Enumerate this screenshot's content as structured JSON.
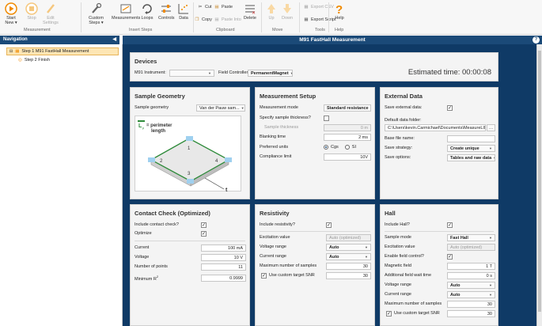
{
  "ribbon": {
    "buttons": [
      {
        "id": "start",
        "label": "Start\nNew ▾",
        "enabled": true
      },
      {
        "id": "stop",
        "label": "Stop",
        "enabled": false
      },
      {
        "id": "edit",
        "label": "Edit\nSettings",
        "enabled": false
      },
      {
        "id": "custom",
        "label": "Custom\nSteps ▾",
        "enabled": true
      },
      {
        "id": "measurements",
        "label": "Measurements",
        "enabled": true
      },
      {
        "id": "loops",
        "label": "Loops",
        "enabled": true
      },
      {
        "id": "controls",
        "label": "Controls",
        "enabled": true
      },
      {
        "id": "data",
        "label": "Data",
        "enabled": true
      }
    ],
    "clipboard": {
      "cut": "Cut",
      "paste": "Paste",
      "copy": "Copy",
      "paste_into": "Paste Into",
      "delete": "Delete"
    },
    "move": {
      "up": "Up",
      "down": "Down"
    },
    "tools": {
      "export_csv": "Export CSV",
      "export_script": "Export Script"
    },
    "help": "Help",
    "groups": {
      "measurement": "Measurement",
      "insert_steps": "Insert Steps",
      "clipboard": "Clipboard",
      "move": "Move",
      "tools": "Tools",
      "help": "Help"
    }
  },
  "navigation": {
    "title": "Navigation",
    "items": [
      {
        "label": "Step 1 M91 FastHall Measurement",
        "selected": true
      },
      {
        "label": "Step 2 Finish",
        "selected": false
      }
    ]
  },
  "main": {
    "title": "M91 FastHall Measurement"
  },
  "devices": {
    "title": "Devices",
    "instrument_label": "M91 Instrument:",
    "instrument_value": "",
    "field_controller_label": "Field Controller:",
    "field_controller_value": "PermanentMagnet",
    "estimated_time": "Estimated time:  00:00:08"
  },
  "sample_geometry": {
    "title": "Sample Geometry",
    "label": "Sample geometry",
    "value": "Van der Pauw sam...",
    "diagram": {
      "legend": "= perimeter\nlength",
      "lp": "L",
      "lp_sub": "p",
      "t": "t",
      "corners": [
        "1",
        "2",
        "3",
        "4"
      ]
    }
  },
  "measurement_setup": {
    "title": "Measurement Setup",
    "mode_label": "Measurement mode",
    "mode_value": "Standard resistance",
    "thickness_q": "Specify sample thickness?",
    "thickness_label": "Sample thickness",
    "thickness_value": "0 m",
    "blanking_label": "Blanking time",
    "blanking_value": "2 ms",
    "units_label": "Preferred units",
    "unit_cgs": "Cgs",
    "unit_si": "SI",
    "compliance_label": "Compliance limit",
    "compliance_value": "10V"
  },
  "external_data": {
    "title": "External Data",
    "save_label": "Save external data:",
    "folder_label": "Default data folder:",
    "folder_value": "C:\\Users\\kevin.Carmichael\\Documents\\MeasureLINK\\D",
    "base_label": "Base file name:",
    "base_value": "",
    "strategy_label": "Save strategy:",
    "strategy_value": "Create unique",
    "options_label": "Save options:",
    "options_value": "Tables and raw data"
  },
  "contact_check": {
    "title": "Contact Check (Optimized)",
    "include_label": "Include contact check?",
    "optimize_label": "Optimize",
    "current_label": "Current",
    "current_value": "100 mA",
    "voltage_label": "Voltage",
    "voltage_value": "10 V",
    "points_label": "Number of points",
    "points_value": "11",
    "minr_label": "Minimum R",
    "minr_sup": "2",
    "minr_value": "0.9999"
  },
  "resistivity": {
    "title": "Resistivity",
    "include_label": "Include resistivity?",
    "excitation_label": "Excitation value",
    "excitation_value": "Auto (optimized)",
    "vrange_label": "Voltage range",
    "vrange_value": "Auto",
    "crange_label": "Current range",
    "crange_value": "Auto",
    "maxsamples_label": "Maximum number of samples",
    "maxsamples_value": "30",
    "snr_label": "Use custom target SNR",
    "snr_value": "30"
  },
  "hall": {
    "title": "Hall",
    "include_label": "Include Hall?",
    "mode_label": "Sample mode",
    "mode_value": "Fast Hall",
    "excitation_label": "Excitation value",
    "excitation_value": "Auto (optimized)",
    "field_label": "Enable field control?",
    "magnetic_label": "Magnetic field",
    "magnetic_value": "1 T",
    "wait_label": "Additional field wait time",
    "wait_value": "0 s",
    "vrange_label": "Voltage range",
    "vrange_value": "Auto",
    "crange_label": "Current range",
    "crange_value": "Auto",
    "maxsamples_label": "Maximum number of samples",
    "maxsamples_value": "30",
    "snr_label": "Use custom target SNR",
    "snr_value": "30"
  },
  "colors": {
    "nav_header": "#1b4a78",
    "main_bg": "#0f3a66",
    "accent": "#f08a00",
    "diagram_green": "#2e8b3a"
  }
}
